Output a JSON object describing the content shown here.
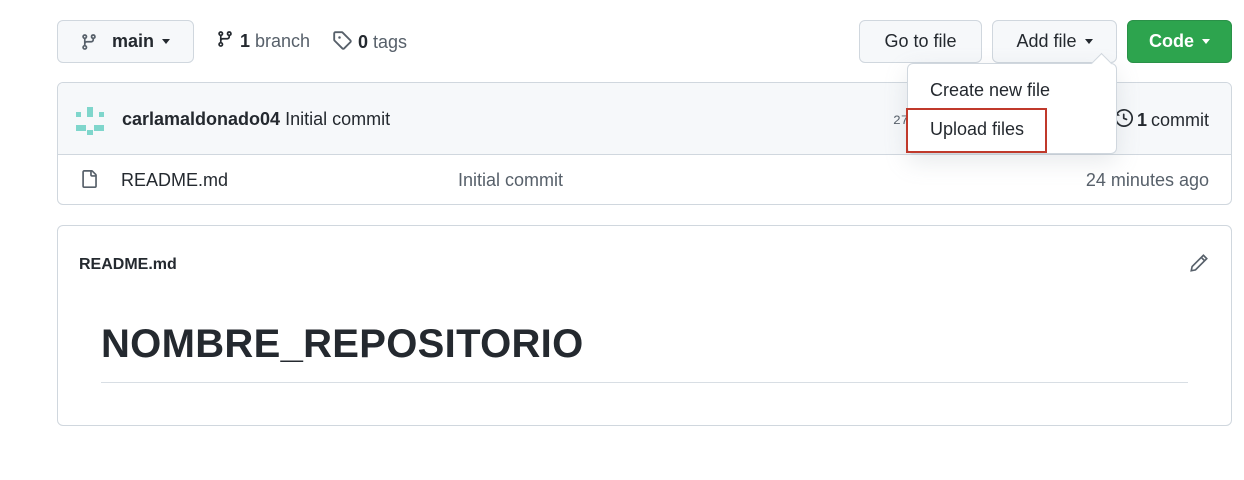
{
  "toolbar": {
    "branch_name": "main",
    "branch_count": "1",
    "branch_label": "branch",
    "tag_count": "0",
    "tag_label": "tags",
    "goto_file_label": "Go to file",
    "add_file_label": "Add file",
    "code_label": "Code"
  },
  "add_file_menu": {
    "items": [
      {
        "label": "Create new file"
      },
      {
        "label": "Upload files"
      }
    ]
  },
  "latest_commit": {
    "author": "carlamaldonado04",
    "message": "Initial commit",
    "hash_partial": "27",
    "commit_count": "1",
    "commit_label": "commit"
  },
  "files": [
    {
      "name": "README.md",
      "message": "Initial commit",
      "time": "24 minutes ago"
    }
  ],
  "readme": {
    "title": "README.md",
    "heading": "NOMBRE_REPOSITORIO"
  },
  "colors": {
    "code_button": "#2da44e",
    "highlight": "#c0392b"
  },
  "icons": [
    "branch-icon",
    "tag-icon",
    "clock-icon",
    "file-icon",
    "pencil-icon",
    "avatar-identicon"
  ]
}
